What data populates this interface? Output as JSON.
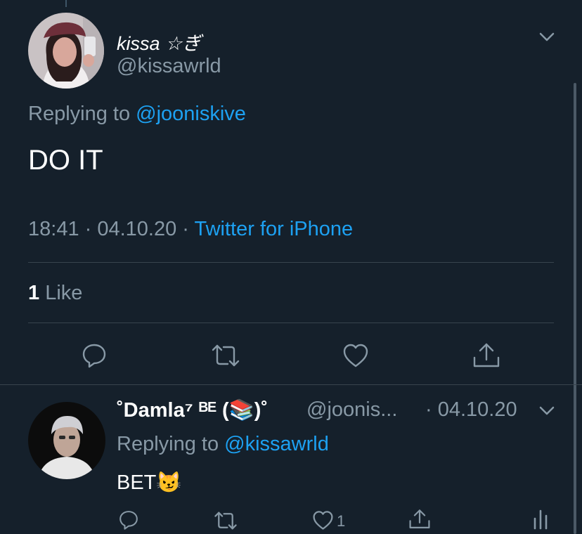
{
  "main_tweet": {
    "display_name": "kissa ☆ぎ",
    "handle": "@kissawrld",
    "replying_prefix": "Replying to",
    "replying_to": "@jooniskive",
    "text": "DO IT",
    "time": "18:41 · 04.10.20 · ",
    "source": "Twitter for iPhone",
    "like_count": "1",
    "like_label": "Like"
  },
  "reply_tweet": {
    "display_name": "˚Damla⁷ ᴮᴱ (📚)˚",
    "handle": "@joonis...",
    "date": "· 04.10.20",
    "replying_prefix": "Replying to",
    "replying_to": "@kissawrld",
    "text": "BET😼",
    "like_count": "1"
  },
  "icons": {
    "menu": "chevron-down-icon",
    "reply": "reply-icon",
    "retweet": "retweet-icon",
    "like": "heart-icon",
    "share": "share-icon",
    "analytics": "analytics-icon"
  },
  "colors": {
    "background": "#15202b",
    "link": "#1da1f2",
    "secondary_text": "#8899a6",
    "divider": "#38444d"
  }
}
